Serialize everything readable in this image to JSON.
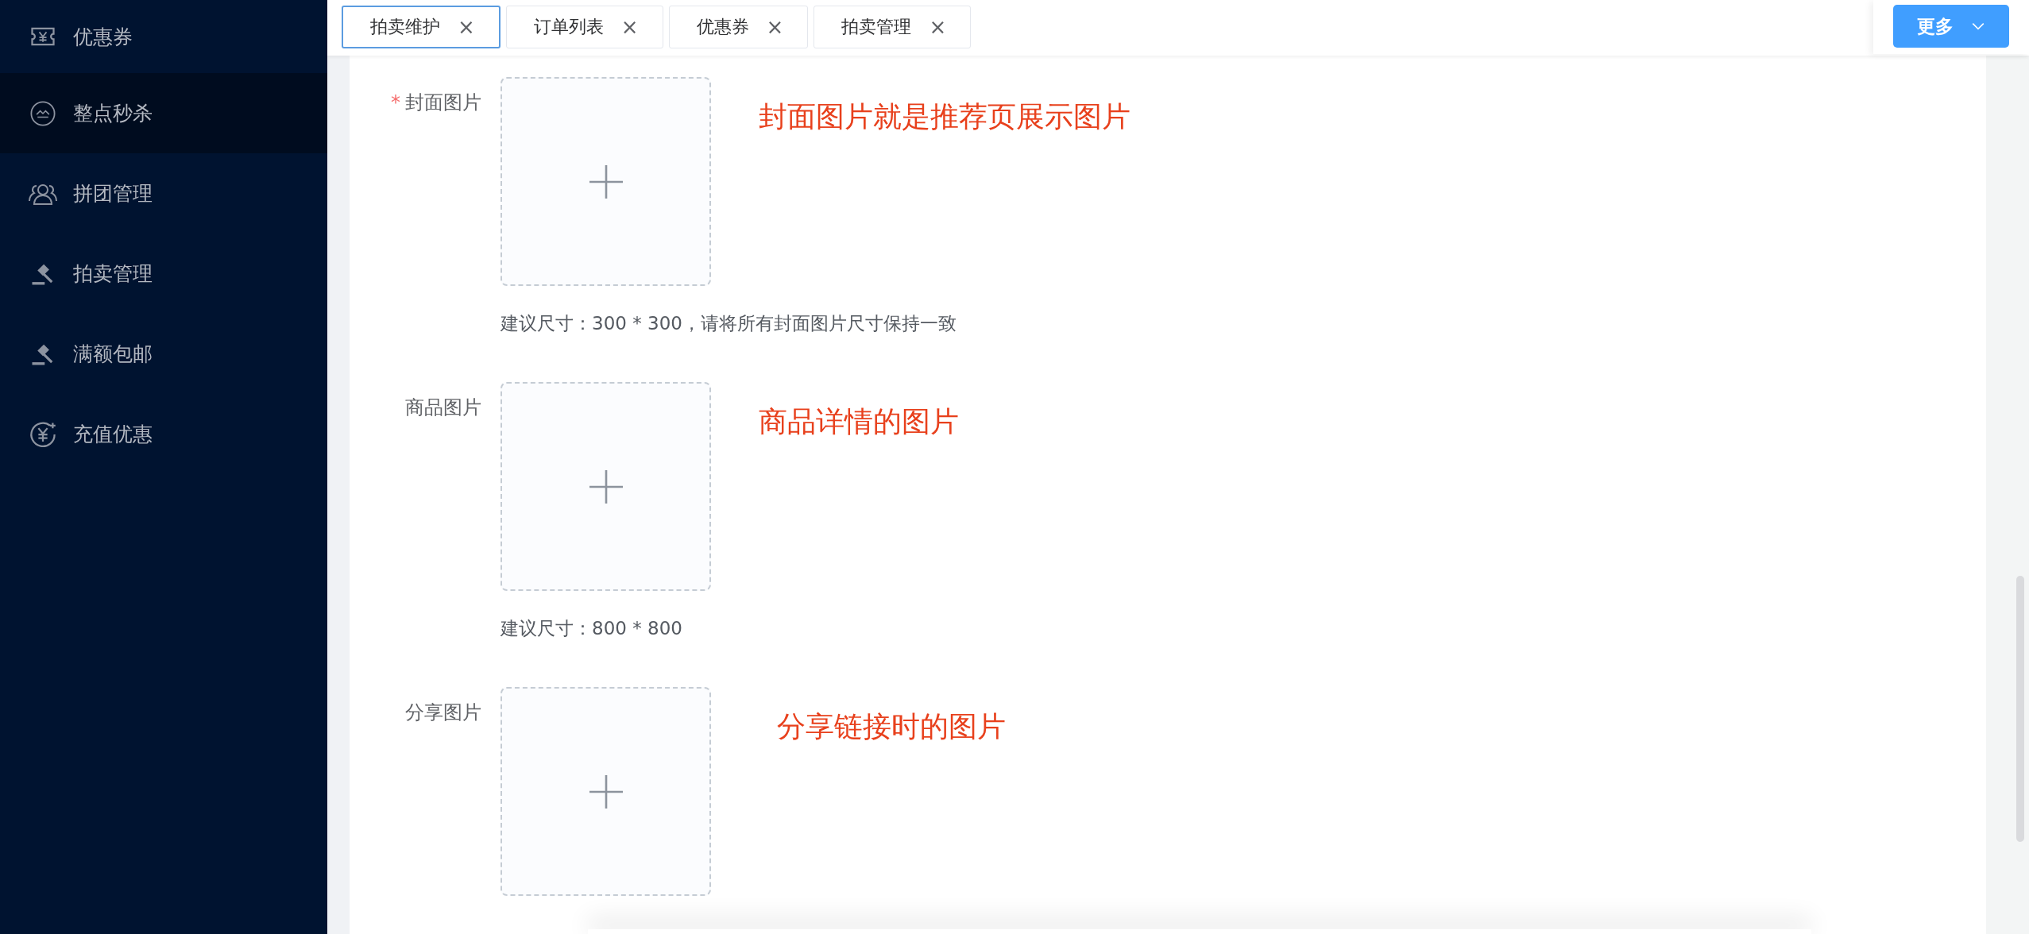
{
  "sidebar": {
    "items": [
      {
        "label": "优惠券",
        "kind": "ticket",
        "selected": false
      },
      {
        "label": "整点秒杀",
        "kind": "badge",
        "selected": true
      },
      {
        "label": "拼团管理",
        "kind": "group",
        "selected": false
      },
      {
        "label": "拍卖管理",
        "kind": "gavel",
        "selected": false
      },
      {
        "label": "满额包邮",
        "kind": "gavel",
        "selected": false
      },
      {
        "label": "充值优惠",
        "kind": "coin",
        "selected": false
      }
    ]
  },
  "tabs": [
    {
      "label": "拍卖维护",
      "close": "×",
      "selected": true
    },
    {
      "label": "订单列表",
      "close": "×",
      "selected": false
    },
    {
      "label": "优惠券",
      "close": "×",
      "selected": false
    },
    {
      "label": "拍卖管理",
      "close": "×",
      "selected": false
    }
  ],
  "more_button": {
    "label": "更多"
  },
  "form": {
    "fields": [
      {
        "label": "封面图片",
        "required_mark": "*",
        "hint": "建议尺寸：300 * 300，请将所有封面图片尺寸保持一致",
        "annotation": "封面图片就是推荐页展示图片"
      },
      {
        "label": "商品图片",
        "hint": "建议尺寸：800 * 800",
        "annotation": "商品详情的图片"
      },
      {
        "label": "分享图片",
        "annotation": "分享链接时的图片"
      }
    ]
  }
}
